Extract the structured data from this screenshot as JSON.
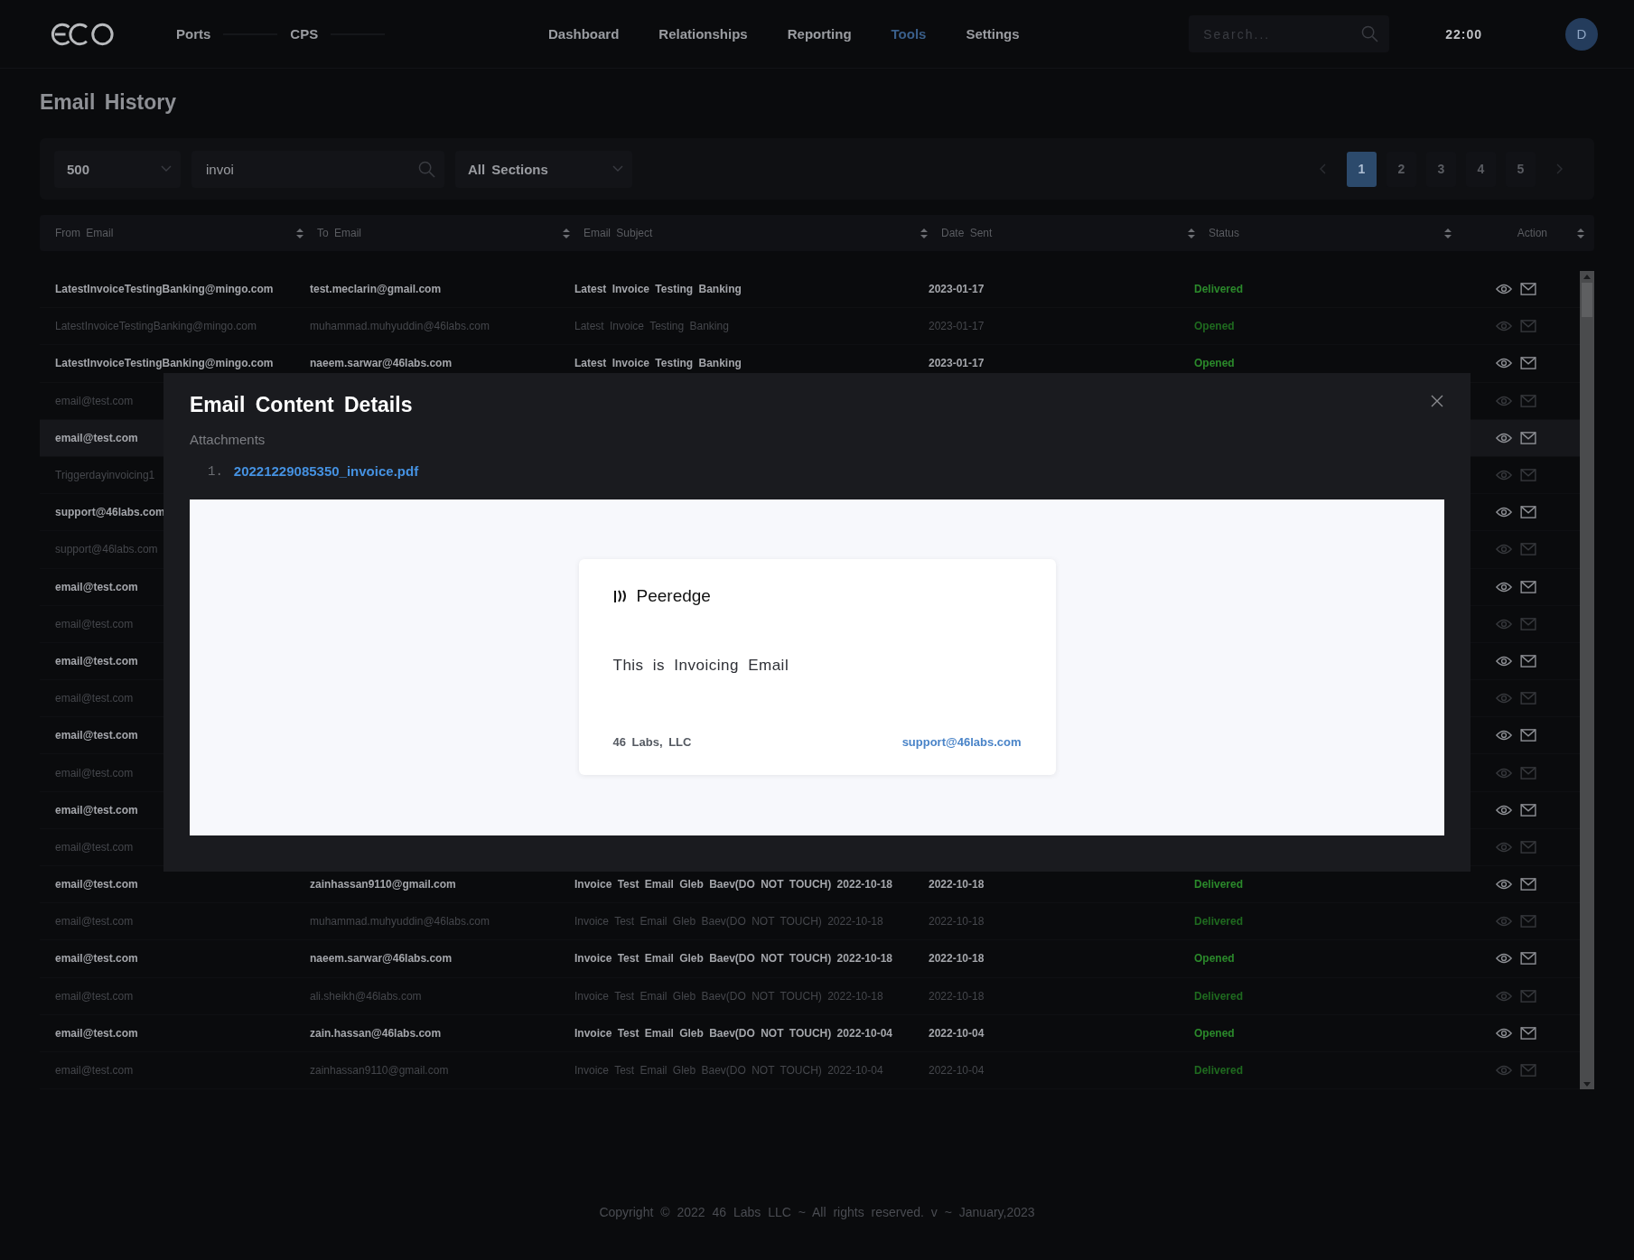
{
  "nav": {
    "left_items": [
      {
        "label": "Ports"
      },
      {
        "label": "CPS"
      }
    ],
    "items": [
      {
        "label": "Dashboard",
        "selected": false
      },
      {
        "label": "Relationships",
        "selected": false
      },
      {
        "label": "Reporting",
        "selected": false
      },
      {
        "label": "Tools",
        "selected": true
      },
      {
        "label": "Settings",
        "selected": false
      }
    ],
    "search": {
      "placeholder": "Search..."
    },
    "time": "22:00",
    "avatar": "D"
  },
  "page_title": "Email History",
  "toolbar": {
    "page_size": "500",
    "search": {
      "value": "invoi"
    },
    "section": "All Sections",
    "pages": [
      {
        "label": "1",
        "selected": true
      },
      {
        "label": "2",
        "selected": false
      },
      {
        "label": "3",
        "selected": false
      },
      {
        "label": "4",
        "selected": false
      },
      {
        "label": "5",
        "selected": false
      }
    ]
  },
  "table": {
    "columns": [
      "From Email",
      "To Email",
      "Email Subject",
      "Date Sent",
      "Status",
      "Action"
    ],
    "rows": [
      {
        "from_email": "LatestInvoiceTestingBanking@mingo.com",
        "to_email": "test.meclarin@gmail.com",
        "subject": "Latest Invoice Testing Banking",
        "date_sent": "2023-01-17",
        "status": "Delivered",
        "muted": false,
        "selected": false
      },
      {
        "from_email": "LatestInvoiceTestingBanking@mingo.com",
        "to_email": "muhammad.muhyuddin@46labs.com",
        "subject": "Latest Invoice Testing Banking",
        "date_sent": "2023-01-17",
        "status": "Opened",
        "muted": true,
        "selected": false
      },
      {
        "from_email": "LatestInvoiceTestingBanking@mingo.com",
        "to_email": "naeem.sarwar@46labs.com",
        "subject": "Latest Invoice Testing Banking",
        "date_sent": "2023-01-17",
        "status": "Opened",
        "muted": false,
        "selected": false
      },
      {
        "from_email": "email@test.com",
        "muted": true,
        "selected": false
      },
      {
        "from_email": "email@test.com",
        "muted": false,
        "selected": true
      },
      {
        "from_email": "Triggerdayinvoicing1",
        "muted": true,
        "selected": false
      },
      {
        "from_email": "support@46labs.com",
        "muted": false,
        "selected": false
      },
      {
        "from_email": "support@46labs.com",
        "muted": true,
        "selected": false
      },
      {
        "from_email": "email@test.com",
        "muted": false,
        "selected": false
      },
      {
        "from_email": "email@test.com",
        "muted": true,
        "selected": false
      },
      {
        "from_email": "email@test.com",
        "muted": false,
        "selected": false
      },
      {
        "from_email": "email@test.com",
        "muted": true,
        "selected": false
      },
      {
        "from_email": "email@test.com",
        "muted": false,
        "selected": false
      },
      {
        "from_email": "email@test.com",
        "muted": true,
        "selected": false
      },
      {
        "from_email": "email@test.com",
        "muted": false,
        "selected": false
      },
      {
        "from_email": "email@test.com",
        "muted": true,
        "selected": false
      },
      {
        "from_email": "email@test.com",
        "to_email": "zainhassan9110@gmail.com",
        "subject": "Invoice Test Email Gleb Baev(DO NOT TOUCH) 2022-10-18",
        "date_sent": "2022-10-18",
        "status": "Delivered",
        "muted": false,
        "selected": false
      },
      {
        "from_email": "email@test.com",
        "to_email": "muhammad.muhyuddin@46labs.com",
        "subject": "Invoice Test Email Gleb Baev(DO NOT TOUCH) 2022-10-18",
        "date_sent": "2022-10-18",
        "status": "Delivered",
        "muted": true,
        "selected": false
      },
      {
        "from_email": "email@test.com",
        "to_email": "naeem.sarwar@46labs.com",
        "subject": "Invoice Test Email Gleb Baev(DO NOT TOUCH) 2022-10-18",
        "date_sent": "2022-10-18",
        "status": "Opened",
        "muted": false,
        "selected": false
      },
      {
        "from_email": "email@test.com",
        "to_email": "ali.sheikh@46labs.com",
        "subject": "Invoice Test Email Gleb Baev(DO NOT TOUCH) 2022-10-18",
        "date_sent": "2022-10-18",
        "status": "Delivered",
        "muted": true,
        "selected": false
      },
      {
        "from_email": "email@test.com",
        "to_email": "zain.hassan@46labs.com",
        "subject": "Invoice Test Email Gleb Baev(DO NOT TOUCH) 2022-10-04",
        "date_sent": "2022-10-04",
        "status": "Opened",
        "muted": false,
        "selected": false
      },
      {
        "from_email": "email@test.com",
        "to_email": "zainhassan9110@gmail.com",
        "subject": "Invoice Test Email Gleb Baev(DO NOT TOUCH) 2022-10-04",
        "date_sent": "2022-10-04",
        "status": "Delivered",
        "muted": true,
        "selected": false
      }
    ]
  },
  "modal": {
    "title": "Email Content Details",
    "attachments_label": "Attachments",
    "attachments": [
      {
        "number": "1.",
        "name": "20221229085350_invoice.pdf"
      }
    ],
    "preview": {
      "brand": "Peeredge",
      "message": "This is Invoicing Email",
      "company": "46 Labs, LLC",
      "email": "support@46labs.com"
    }
  },
  "footer": "Copyright © 2022 46 Labs LLC ~ All rights reserved. v ~ January,2023"
}
